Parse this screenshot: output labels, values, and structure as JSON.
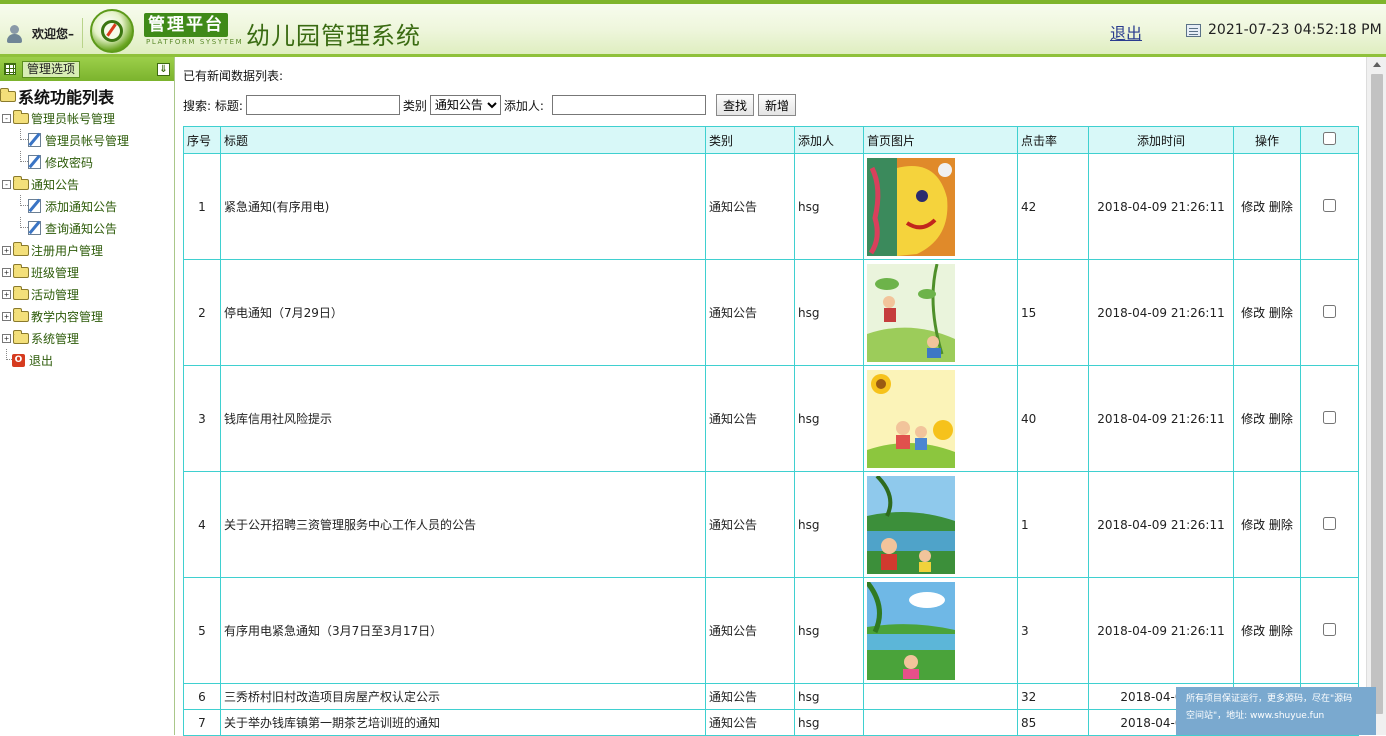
{
  "header": {
    "welcome": "欢迎您–",
    "platform_title": "管理平台",
    "platform_subtitle": "PLATFORM SYSYTEM",
    "system_title": "幼儿园管理系统",
    "logout": "退出",
    "datetime": "2021-07-23 04:52:18 PM"
  },
  "sidebar": {
    "header_label": "管理选项",
    "root_label": "系统功能列表",
    "groups": [
      {
        "label": "管理员帐号管理",
        "expanded": true,
        "children": [
          "管理员帐号管理",
          "修改密码"
        ]
      },
      {
        "label": "通知公告",
        "expanded": true,
        "children": [
          "添加通知公告",
          "查询通知公告"
        ]
      },
      {
        "label": "注册用户管理",
        "expanded": false
      },
      {
        "label": "班级管理",
        "expanded": false
      },
      {
        "label": "活动管理",
        "expanded": false
      },
      {
        "label": "教学内容管理",
        "expanded": false
      },
      {
        "label": "系统管理",
        "expanded": false
      }
    ],
    "exit_label": "退出"
  },
  "main": {
    "caption": "已有新闻数据列表:",
    "search": {
      "label": "搜索: 标题:",
      "title_value": "",
      "category_label": "类别",
      "category_selected": "通知公告",
      "adder_label": "添加人:",
      "adder_value": "",
      "search_button": "查找",
      "add_button": "新增"
    },
    "table": {
      "headers": [
        "序号",
        "标题",
        "类别",
        "添加人",
        "首页图片",
        "点击率",
        "添加时间",
        "操作"
      ],
      "edit_label": "修改",
      "delete_label": "删除",
      "rows": [
        {
          "no": "1",
          "title": "紧急通知(有序用电)",
          "category": "通知公告",
          "adder": "hsg",
          "image": "painting-face",
          "clicks": "42",
          "time": "2018-04-09 21:26:11"
        },
        {
          "no": "2",
          "title": "停电通知（7月29日）",
          "category": "通知公告",
          "adder": "hsg",
          "image": "kids-vines",
          "clicks": "15",
          "time": "2018-04-09 21:26:11"
        },
        {
          "no": "3",
          "title": "钱库信用社风险提示",
          "category": "通知公告",
          "adder": "hsg",
          "image": "sunflower-kids",
          "clicks": "40",
          "time": "2018-04-09 21:26:11"
        },
        {
          "no": "4",
          "title": "关于公开招聘三资管理服务中心工作人员的公告",
          "category": "通知公告",
          "adder": "hsg",
          "image": "kids-lake",
          "clicks": "1",
          "time": "2018-04-09 21:26:11"
        },
        {
          "no": "5",
          "title": "有序用电紧急通知（3月7日至3月17日）",
          "category": "通知公告",
          "adder": "hsg",
          "image": "kid-meadow",
          "clicks": "3",
          "time": "2018-04-09 21:26:11"
        },
        {
          "no": "6",
          "title": "三秀桥村旧村改造项目房屋产权认定公示",
          "category": "通知公告",
          "adder": "hsg",
          "image": "",
          "clicks": "32",
          "time": "2018-04-09 2"
        },
        {
          "no": "7",
          "title": "关于举办钱库镇第一期茶艺培训班的通知",
          "category": "通知公告",
          "adder": "hsg",
          "image": "",
          "clicks": "85",
          "time": "2018-04-09 2"
        }
      ]
    }
  },
  "watermark": {
    "line1": "所有项目保证运行，更多源码，尽在\"源码",
    "line2": "空间站\"，地址: www.shuyue.fun"
  }
}
